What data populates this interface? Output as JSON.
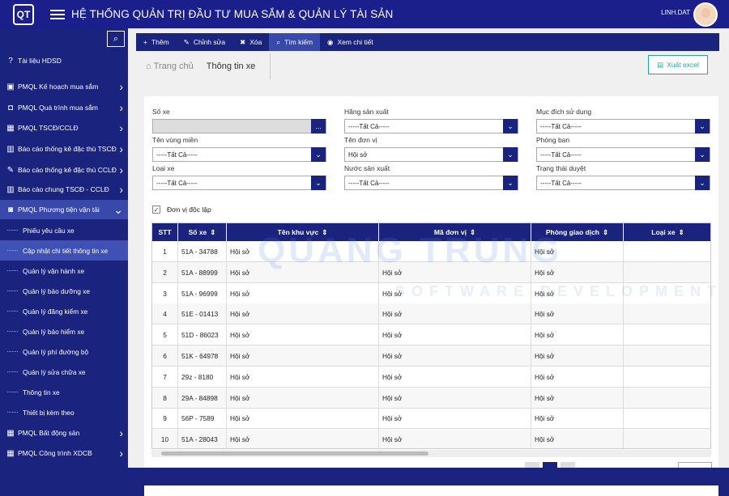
{
  "header": {
    "title": "HỆ THỐNG QUẢN TRỊ ĐẦU TƯ MUA SẮM & QUẢN LÝ TÀI SẢN",
    "user": "LINH.DAT",
    "logo_text": "QT"
  },
  "sidebar": {
    "items": [
      {
        "label": "Tài liệu HDSD",
        "icon": "question-circle-icon",
        "glyph": "?"
      },
      {
        "label": "PMQL Kế hoạch mua sắm",
        "icon": "box-icon",
        "glyph": "▣"
      },
      {
        "label": "PMQL Quá trình mua sắm",
        "icon": "bag-icon",
        "glyph": "◘"
      },
      {
        "label": "PMQL TSCĐ/CCLĐ",
        "icon": "building-icon",
        "glyph": "▦"
      },
      {
        "label": "Báo cáo thống kê đặc thù TSCĐ",
        "icon": "report-icon",
        "glyph": "▥"
      },
      {
        "label": "Báo cáo thống kê đặc thù CCLĐ",
        "icon": "wrench-icon",
        "glyph": "✎"
      },
      {
        "label": "Báo cáo chung TSCĐ - CCLĐ",
        "icon": "report-icon",
        "glyph": "▥"
      },
      {
        "label": "PMQL Phương tiện vận tải",
        "icon": "car-icon",
        "glyph": "◙"
      }
    ],
    "subitems": [
      "Phiếu yêu cầu xe",
      "Cập nhật chi tiết thông tin xe",
      "Quản lý vận hành xe",
      "Quản lý bảo dưỡng xe",
      "Quản lý đăng kiểm xe",
      "Quản lý bảo hiểm xe",
      "Quản lý phí đường bộ",
      "Quản lý sửa chữa xe",
      "Thông tin xe",
      "Thiết bị kèm theo"
    ],
    "bottom_items": [
      {
        "label": "PMQL Bất động sản",
        "icon": "building-icon",
        "glyph": "▦"
      },
      {
        "label": "PMQL Công trình XDCB",
        "icon": "building-icon",
        "glyph": "▦"
      }
    ]
  },
  "toolbar": {
    "buttons": [
      {
        "label": "Thêm",
        "glyph": "+",
        "icon": "plus-icon"
      },
      {
        "label": "Chỉnh sửa",
        "glyph": "✎",
        "icon": "pencil-icon"
      },
      {
        "label": "Xóa",
        "glyph": "✖",
        "icon": "close-icon"
      },
      {
        "label": "Tìm kiếm",
        "glyph": "⌕",
        "icon": "search-icon"
      },
      {
        "label": "Xem chi tiết",
        "glyph": "◉",
        "icon": "eye-icon"
      }
    ]
  },
  "breadcrumb": {
    "home": "Trang chủ",
    "current": "Thông tin xe"
  },
  "export_label": "Xuất excel",
  "filters": {
    "so_xe": {
      "label": "Số xe",
      "value": "",
      "btn": "..."
    },
    "hang_sx": {
      "label": "Hãng sản xuất",
      "value": "-----Tất Cả-----"
    },
    "muc_dich": {
      "label": "Mục đích sử dụng",
      "value": "-----Tất Cả-----"
    },
    "vung_mien": {
      "label": "Tên vùng miền",
      "value": "-----Tất Cả-----"
    },
    "don_vi": {
      "label": "Tên đơn vị",
      "value": "Hội sở"
    },
    "phong_ban": {
      "label": "Phòng ban",
      "value": "-----Tất Cả-----"
    },
    "loai_xe": {
      "label": "Loại xe",
      "value": "-----Tất Cả-----"
    },
    "nuoc_sx": {
      "label": "Nước sản xuất",
      "value": "-----Tất Cả-----"
    },
    "trang_thai": {
      "label": "Trạng thái duyệt",
      "value": "-----Tất Cả-----"
    }
  },
  "checkbox": {
    "label": "Đơn vị độc lập",
    "checked": true
  },
  "table": {
    "headers": [
      "STT",
      "Số xe",
      "Tên khu vực",
      "Mã đơn vị",
      "Phòng giao dịch",
      "Loại xe"
    ],
    "rows": [
      [
        "1",
        "51A - 34788",
        "Hội sở",
        "",
        "Hội sở",
        ""
      ],
      [
        "2",
        "51A - 88999",
        "Hội sở",
        "Hội sở",
        "Hội sở",
        ""
      ],
      [
        "3",
        "51A - 96999",
        "Hội sở",
        "Hội sở",
        "Hội sở",
        ""
      ],
      [
        "4",
        "51E - 01413",
        "Hội sở",
        "Hội sở",
        "Hội sở",
        ""
      ],
      [
        "5",
        "51D - 86023",
        "Hội sở",
        "Hội sở",
        "Hội sở",
        ""
      ],
      [
        "6",
        "51K - 64978",
        "Hội sở",
        "Hội sở",
        "Hội sở",
        ""
      ],
      [
        "7",
        "29z - 8180",
        "Hội sở",
        "Hội sở",
        "Hội sở",
        ""
      ],
      [
        "8",
        "29A - 84898",
        "Hội sở",
        "Hội sở",
        "Hội sở",
        ""
      ],
      [
        "9",
        "56P - 7589",
        "Hội sở",
        "Hội sở",
        "Hội sở",
        ""
      ],
      [
        "10",
        "51A - 28043",
        "Hội sở",
        "Hội sở",
        "Hội sở",
        ""
      ]
    ]
  },
  "watermark": {
    "line1": "QUANG TRUNG",
    "line2": "SOFTWARE DEVELOPMENT"
  },
  "colors": {
    "navy": "#1a237e",
    "accent": "#3949ab",
    "teal": "#26a69a"
  }
}
